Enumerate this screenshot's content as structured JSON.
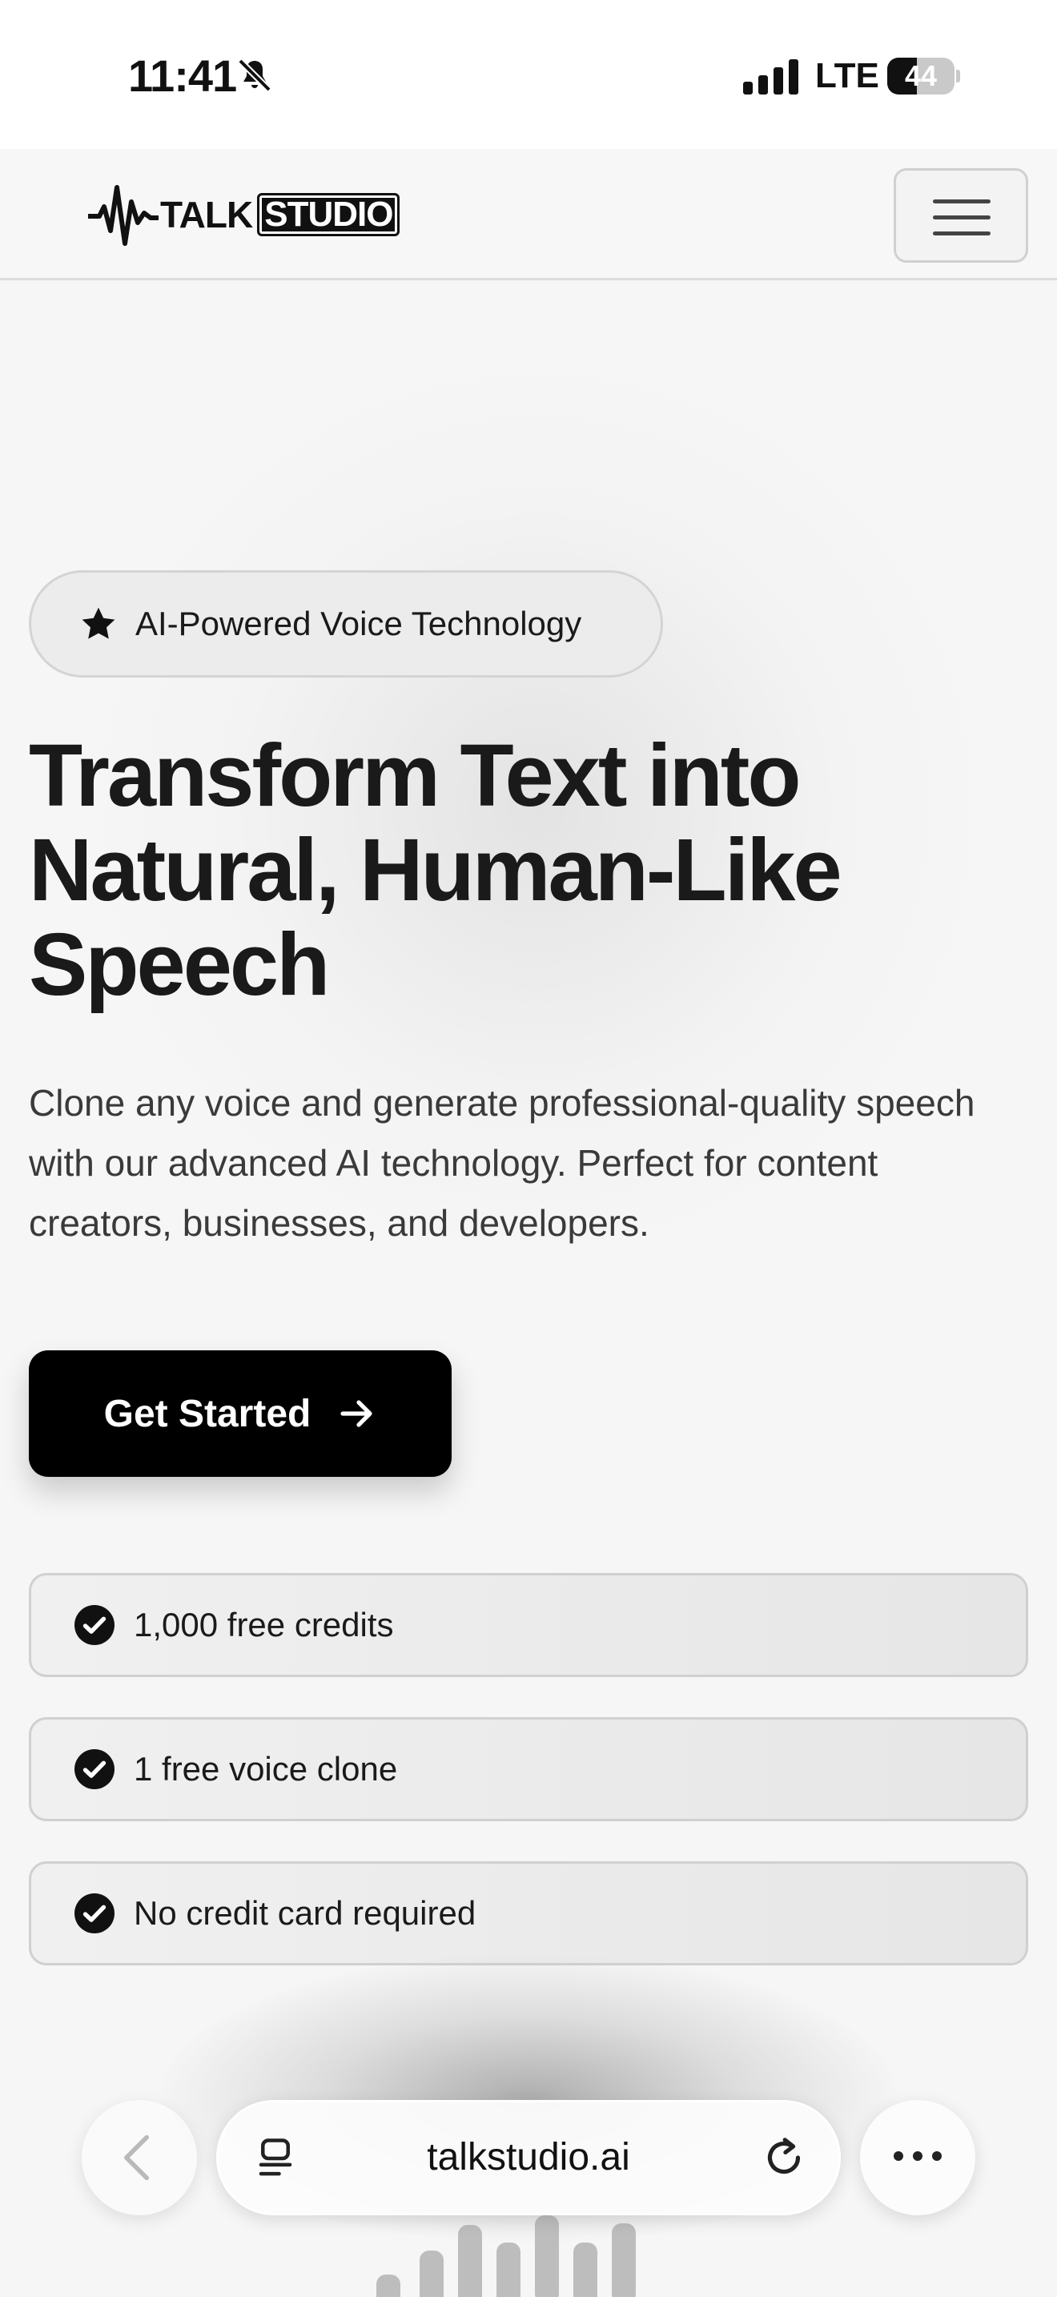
{
  "status_bar": {
    "time": "11:41",
    "network": "LTE",
    "battery": "44",
    "battery_level": 0.44
  },
  "header": {
    "logo_talk": "TALK",
    "logo_studio": "STUDIO"
  },
  "hero": {
    "badge": "AI-Powered Voice Technology",
    "title": "Transform Text into Natural, Human-Like Speech",
    "subtitle": "Clone any voice and generate professional-quality speech with our advanced AI technology. Perfect for content creators, businesses, and developers.",
    "cta_label": "Get Started"
  },
  "features": [
    "1,000 free credits",
    "1 free voice clone",
    "No credit card required"
  ],
  "browser": {
    "url": "talkstudio.ai"
  },
  "icons": {
    "muted": "bell-slash-icon",
    "signal": "signal-bars-icon",
    "logo": "waveform-icon",
    "menu": "hamburger-icon",
    "badge": "star-icon",
    "cta": "arrow-right-icon",
    "feature": "check-circle-icon",
    "back": "chevron-left-icon",
    "tabs": "tabs-icon",
    "reload": "reload-icon",
    "more": "ellipsis-icon"
  }
}
